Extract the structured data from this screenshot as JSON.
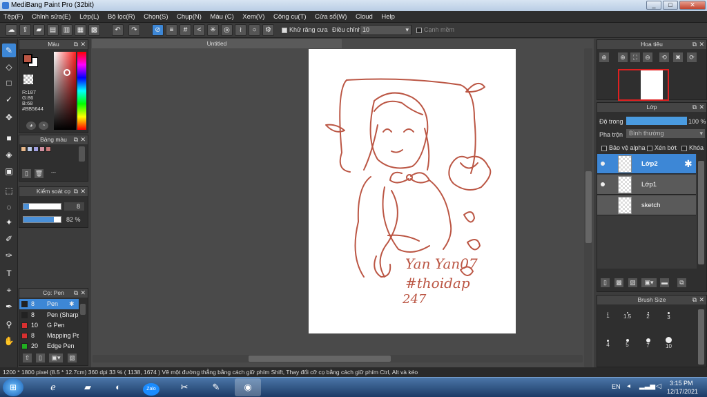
{
  "window": {
    "title": "MediBang Paint Pro (32bit)"
  },
  "menu": [
    "Tệp(F)",
    "Chỉnh sửa(E)",
    "Lớp(L)",
    "Bộ lọc(R)",
    "Chọn(S)",
    "Chụp(N)",
    "Màu (C)",
    "Xem(V)",
    "Công cụ(T)",
    "Cửa sổ(W)",
    "Cloud",
    "Help"
  ],
  "toolbar": {
    "antialias_label": "Khử răng cưa",
    "adjust_label": "Điều chỉnh",
    "adjust_value": "10",
    "edge_label": "Cạnh mềm"
  },
  "color_panel": {
    "title": "Màu",
    "r": "R:187",
    "g": "G:86",
    "b": "B:68",
    "hex": "#BB5644",
    "current_color": "#BB5644"
  },
  "palette_panel": {
    "title": "Bảng màu",
    "swatches": [
      "#e8b88a",
      "#b8c8e8",
      "#a0a0e0",
      "#d090a0",
      "#c87878"
    ],
    "ellipsis": "---"
  },
  "brush_control": {
    "title": "Kiểm soát cọ",
    "size": "8",
    "opacity": "82 %"
  },
  "brush_panel": {
    "title": "Cọ: Pen",
    "items": [
      {
        "size": "8",
        "name": "Pen",
        "color": "#222222"
      },
      {
        "size": "8",
        "name": "Pen (Sharp)",
        "color": "#222222"
      },
      {
        "size": "10",
        "name": "G Pen",
        "color": "#d83030"
      },
      {
        "size": "8",
        "name": "Mapping Pen",
        "color": "#d83030"
      },
      {
        "size": "20",
        "name": "Edge Pen",
        "color": "#20b020"
      }
    ]
  },
  "document": {
    "tab": "Untitled"
  },
  "navigator": {
    "title": "Hoa tiêu"
  },
  "layer_panel": {
    "title": "Lớp",
    "opacity_label": "Độ trong",
    "opacity_value": "100 %",
    "opacity_fraction": 1.0,
    "blend_label": "Pha trộn",
    "blend_value": "Bình thường",
    "protect_alpha": "Bảo vệ alpha",
    "clipping": "Xén bớt",
    "lock": "Khóa",
    "layers": [
      {
        "name": "Lớp2"
      },
      {
        "name": "Lớp1"
      },
      {
        "name": "sketch"
      }
    ]
  },
  "brush_size_panel": {
    "title": "Brush Size",
    "sizes": [
      "1",
      "1.5",
      "2",
      "3",
      "4",
      "5",
      "7",
      "10"
    ]
  },
  "artwork_text": {
    "line1": "Yan Yan07",
    "line2": "#thoidap",
    "line3": "247"
  },
  "status": {
    "text": "1200 * 1800 pixel  (8.5 * 12.7cm)  360 dpi  33 %  ( 1138, 1674 )  Vẽ một đường thẳng bằng cách giữ phím Shift, Thay đổi cỡ cọ bằng cách giữ phím Ctrl, Alt và kéo"
  },
  "taskbar": {
    "lang": "EN",
    "time": "3:15 PM",
    "date": "12/17/2021",
    "zalo": "Zalo"
  }
}
